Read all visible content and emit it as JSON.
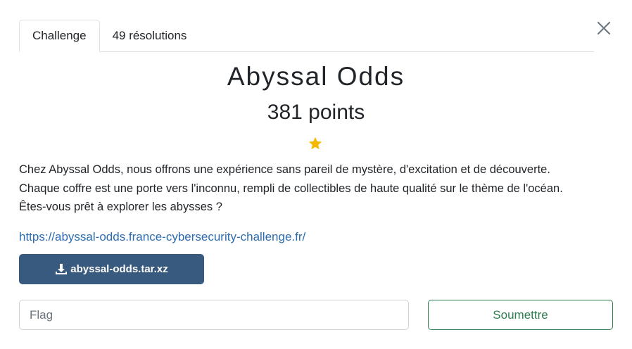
{
  "tabs": [
    {
      "label": "Challenge",
      "active": true
    },
    {
      "label": "49 résolutions",
      "active": false
    }
  ],
  "challenge": {
    "title": "Abyssal Odds",
    "points": "381 points",
    "difficulty_stars": 1,
    "star_color": "#f5b800",
    "description": [
      "Chez Abyssal Odds, nous offrons une expérience sans pareil de mystère, d'excitation et de découverte.",
      "Chaque coffre est une porte vers l'inconnu, rempli de collectibles de haute qualité sur le thème de l'océan.",
      "Êtes-vous prêt à explorer les abysses ?"
    ],
    "link": "https://abyssal-odds.france-cybersecurity-challenge.fr/",
    "download_label": "abyssal-odds.tar.xz"
  },
  "form": {
    "flag_placeholder": "Flag",
    "flag_value": "",
    "submit_label": "Soumettre"
  },
  "icons": {
    "close": "close-icon",
    "star": "star-icon",
    "download": "download-icon"
  },
  "colors": {
    "download_button": "#385a7f",
    "submit_accent": "#2e7d4f",
    "link": "#2b6cb0"
  }
}
